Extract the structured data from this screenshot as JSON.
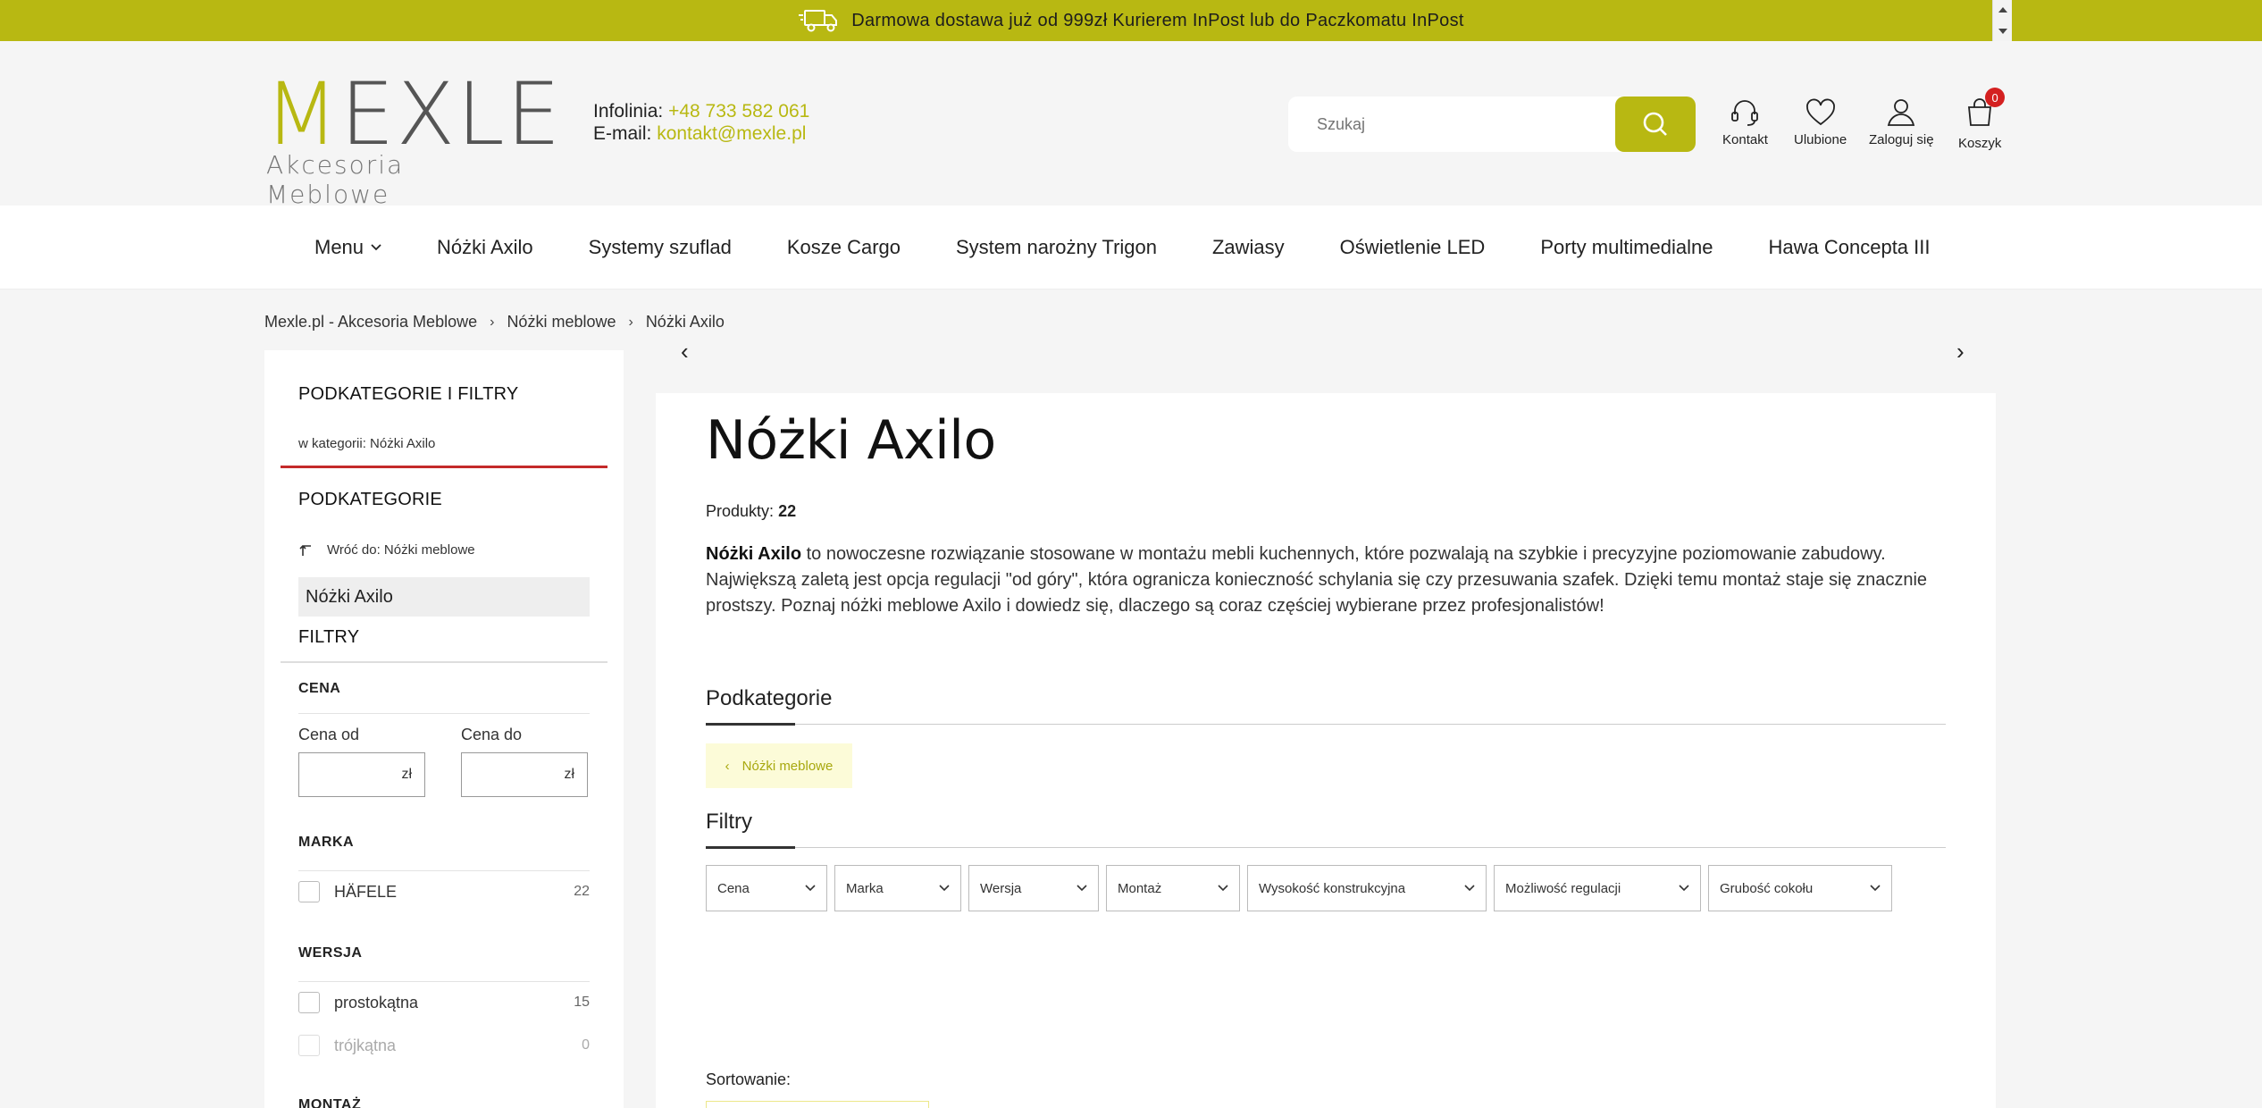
{
  "topbar": {
    "text": "Darmowa dostawa już od 999zł Kurierem InPost lub do Paczkomatu InPost"
  },
  "header": {
    "logo_word_first": "M",
    "logo_word_rest": "EXLE",
    "logo_sub": "Akcesoria Meblowe",
    "phone_label": "Infolinia:",
    "phone": "+48 733 582 061",
    "email_label": "E-mail:",
    "email": "kontakt@mexle.pl",
    "search_placeholder": "Szukaj",
    "icons": {
      "contact": "Kontakt",
      "favorites": "Ulubione",
      "login": "Zaloguj się",
      "cart": "Koszyk",
      "cart_count": "0"
    }
  },
  "nav": {
    "items": [
      "Menu",
      "Nóżki Axilo",
      "Systemy szuflad",
      "Kosze Cargo",
      "System narożny Trigon",
      "Zawiasy",
      "Oświetlenie LED",
      "Porty multimedialne",
      "Hawa Concepta III"
    ]
  },
  "breadcrumb": [
    "Mexle.pl - Akcesoria Meblowe",
    "Nóżki meblowe",
    "Nóżki Axilo"
  ],
  "sidebar": {
    "title": "PODKATEGORIE I FILTRY",
    "in_category": "w kategorii: Nóżki Axilo",
    "subcategories_title": "PODKATEGORIE",
    "back_to": "Wróć do: Nóżki meblowe",
    "current": "Nóżki Axilo",
    "filters_title": "FILTRY",
    "price_title": "CENA",
    "price_from_label": "Cena od",
    "price_to_label": "Cena do",
    "currency": "zł",
    "brand_title": "MARKA",
    "brand_items": [
      {
        "label": "HÄFELE",
        "count": "22"
      }
    ],
    "version_title": "WERSJA",
    "version_items": [
      {
        "label": "prostokątna",
        "count": "15"
      },
      {
        "label": "trójkątna",
        "count": "0"
      }
    ],
    "mount_title": "MONTAŻ"
  },
  "main": {
    "title": "Nóżki Axilo",
    "products_label": "Produkty:",
    "products_count": "22",
    "desc_bold": "Nóżki Axilo",
    "desc_rest": " to nowoczesne rozwiązanie stosowane w montażu mebli kuchennych, które pozwalają na szybkie i precyzyjne poziomowanie zabudowy. Największą zaletą jest opcja regulacji \"od góry\", która ogranicza konieczność schylania się czy przesuwania szafek. Dzięki temu montaż staje się znacznie prostszy. Poznaj nóżki meblowe Axilo i dowiedz się, dlaczego są coraz częściej wybierane przez profesjonalistów!",
    "subcategories_heading": "Podkategorie",
    "subcat_chip": "Nóżki meblowe",
    "filters_heading": "Filtry",
    "filters": [
      "Cena",
      "Marka",
      "Wersja",
      "Montaż",
      "Wysokość konstrukcyjna",
      "Możliwość regulacji",
      "Grubość cokołu"
    ],
    "sort_label": "Sortowanie:"
  },
  "colors": {
    "accent": "#b8b812",
    "badge": "#d42020",
    "sidebar_divider": "#c42a2a"
  }
}
